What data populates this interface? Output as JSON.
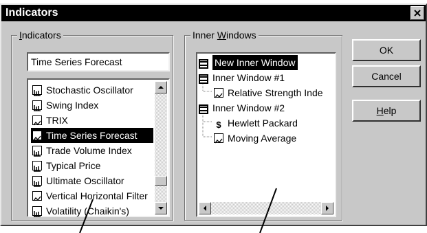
{
  "window": {
    "title": "Indicators",
    "close_glyph": "×"
  },
  "indicators_group": {
    "label_mnemonic": "I",
    "label_rest": "ndicators",
    "search_value": "Time Series Forecast",
    "items": [
      {
        "label": "Stochastic Oscillator",
        "icon": "bar-chart-icon",
        "selected": false
      },
      {
        "label": "Swing Index",
        "icon": "bar-chart-icon",
        "selected": false
      },
      {
        "label": "TRIX",
        "icon": "line-chart-icon",
        "selected": false
      },
      {
        "label": "Time Series Forecast",
        "icon": "line-chart-icon",
        "selected": true
      },
      {
        "label": "Trade Volume Index",
        "icon": "bar-chart-icon",
        "selected": false
      },
      {
        "label": "Typical Price",
        "icon": "bar-chart-icon",
        "selected": false
      },
      {
        "label": "Ultimate Oscillator",
        "icon": "bar-chart-icon",
        "selected": false
      },
      {
        "label": "Vertical Horizontal Filter",
        "icon": "line-chart-icon",
        "selected": false
      },
      {
        "label": "Volatility (Chaikin's)",
        "icon": "bar-chart-icon",
        "selected": false
      }
    ]
  },
  "inner_windows_group": {
    "label_prefix": "Inner ",
    "label_mnemonic": "W",
    "label_rest": "indows",
    "tree": [
      {
        "label": "New Inner Window",
        "icon": "window-icon",
        "selected": true
      },
      {
        "label": "Inner Window #1",
        "icon": "window-icon",
        "selected": false
      },
      {
        "label": "Relative Strength Inde",
        "icon": "line-chart-icon",
        "selected": false
      },
      {
        "label": "Inner Window #2",
        "icon": "window-icon",
        "selected": false
      },
      {
        "label": "Hewlett Packard",
        "icon": "dollar-icon",
        "selected": false
      },
      {
        "label": "Moving Average",
        "icon": "line-chart-icon",
        "selected": false
      }
    ]
  },
  "buttons": {
    "ok": "OK",
    "cancel": "Cancel",
    "help_mnemonic": "H",
    "help_rest": "elp"
  }
}
